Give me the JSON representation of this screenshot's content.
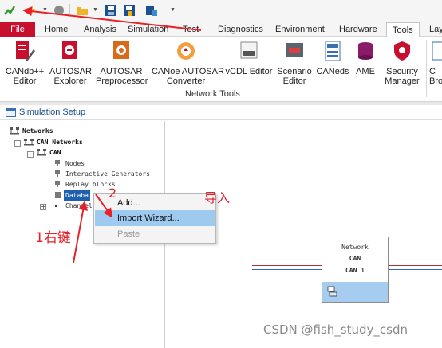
{
  "quick_access": {
    "icons": [
      "run-icon",
      "lightning-icon",
      "stop-icon",
      "open-folder-icon",
      "save-icon",
      "save-all-icon",
      "configuration-icon",
      "customize-icon"
    ]
  },
  "ribbon_tabs": [
    {
      "label": "File",
      "active": false
    },
    {
      "label": "Home",
      "active": false
    },
    {
      "label": "Analysis",
      "active": false
    },
    {
      "label": "Simulation",
      "active": false
    },
    {
      "label": "Test",
      "active": false
    },
    {
      "label": "Diagnostics",
      "active": false
    },
    {
      "label": "Environment",
      "active": false
    },
    {
      "label": "Hardware",
      "active": false
    },
    {
      "label": "Tools",
      "active": true
    },
    {
      "label": "Lay",
      "active": false
    }
  ],
  "ribbon": {
    "buttons": [
      {
        "line1": "CANdb++",
        "line2": "Editor"
      },
      {
        "line1": "AUTOSAR",
        "line2": "Explorer"
      },
      {
        "line1": "AUTOSAR",
        "line2": "Preprocessor"
      },
      {
        "line1": "CANoe AUTOSAR",
        "line2": "Converter"
      },
      {
        "line1": "vCDL Editor",
        "line2": ""
      },
      {
        "line1": "Scenario",
        "line2": "Editor"
      },
      {
        "line1": "CANeds",
        "line2": ""
      },
      {
        "line1": "AME",
        "line2": ""
      },
      {
        "line1": "Security",
        "line2": "Manager"
      },
      {
        "line1": "C",
        "line2": "Bro"
      }
    ],
    "group_label": "Network Tools"
  },
  "window": {
    "title": "Simulation Setup"
  },
  "tree": {
    "networks": "Networks",
    "can_networks": "CAN Networks",
    "can": "CAN",
    "nodes": "Nodes",
    "interactive_generators": "Interactive Generators",
    "replay_blocks": "Replay blocks",
    "databases": "Databa",
    "channels": "Channel"
  },
  "context_menu": {
    "items": [
      {
        "label": "Add...",
        "enabled": true,
        "highlighted": false
      },
      {
        "label": "Import Wizard...",
        "enabled": true,
        "highlighted": true
      },
      {
        "label": "Paste",
        "enabled": false,
        "highlighted": false
      }
    ]
  },
  "network_block": {
    "line1": "Network",
    "line2": "CAN",
    "line3": "CAN 1"
  },
  "annotations": {
    "step1": "1右键",
    "step2": "2",
    "note": "导入"
  },
  "watermark": "CSDN @fish_study_csdn",
  "colors": {
    "file_tab": "#c8102e",
    "selection": "#1e5fb0",
    "menu_highlight": "#9ecaf0",
    "annotation": "#e8202a"
  }
}
